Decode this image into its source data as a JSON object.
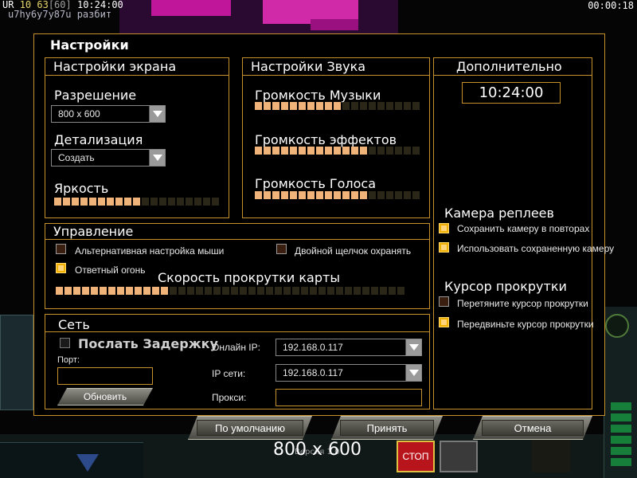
{
  "hud": {
    "player": "UR",
    "level": "10",
    "fps": "63",
    "fps_max": "[60]",
    "clock": "10:24:00",
    "player_status": "u7hy6y7y87u разбит",
    "game_timer": "00:00:18"
  },
  "dialog": {
    "title": "Настройки"
  },
  "screen": {
    "title": "Настройки экрана",
    "resolution_label": "Разрешение",
    "resolution_value": "800 x 600",
    "detail_label": "Детализация",
    "detail_value": "Создать",
    "brightness_label": "Яркость",
    "brightness_level": 0.5
  },
  "sound": {
    "title": "Настройки Звука",
    "music_label": "Громкость Музыки",
    "music_level": 0.5,
    "effects_label": "Громкость эффектов",
    "effects_level": 0.7,
    "voice_label": "Громкость Голоса",
    "voice_level": 0.7
  },
  "controls": {
    "title": "Управление",
    "alt_mouse_label": "Альтернативная настройка мыши",
    "alt_mouse_checked": false,
    "double_click_label": "Двойной щелчок охранять",
    "double_click_checked": false,
    "retaliation_label": "Ответный огонь",
    "retaliation_checked": true,
    "scroll_speed_label": "Скорость прокрутки карты",
    "scroll_speed_level": 0.33
  },
  "network": {
    "title": "Сеть",
    "send_delay_label": "Послать Задержку",
    "send_delay_checked": false,
    "port_label": "Порт:",
    "port_value": "",
    "refresh_label": "Обновить",
    "online_ip_label": "Онлайн IP:",
    "online_ip_value": "192.168.0.117",
    "lan_ip_label": "IP сети:",
    "lan_ip_value": "192.168.0.117",
    "proxy_label": "Прокси:",
    "proxy_value": ""
  },
  "extra": {
    "title": "Дополнительно",
    "time_value": "10:24:00",
    "replay_camera_title": "Камера реплеев",
    "save_camera_label": "Сохранить камеру в повторах",
    "save_camera_checked": true,
    "use_saved_camera_label": "Использовать сохраненную камеру",
    "use_saved_camera_checked": true,
    "scroll_cursor_title": "Курсор прокрутки",
    "drag_cursor_label": "Перетяните курсор прокрутки",
    "drag_cursor_checked": false,
    "move_cursor_label": "Передвиньте курсор прокрутки",
    "move_cursor_checked": true
  },
  "buttons": {
    "defaults": "По умолчанию",
    "accept": "Принять",
    "cancel": "Отмена"
  },
  "footer": {
    "resolution": "800 x 600",
    "version": "Версия 1.0"
  },
  "background": {
    "stop_label": "СТОП"
  },
  "colors": {
    "border": "#c8902a",
    "slider_on": "#f0b47a",
    "check_on": "#f0b000"
  }
}
